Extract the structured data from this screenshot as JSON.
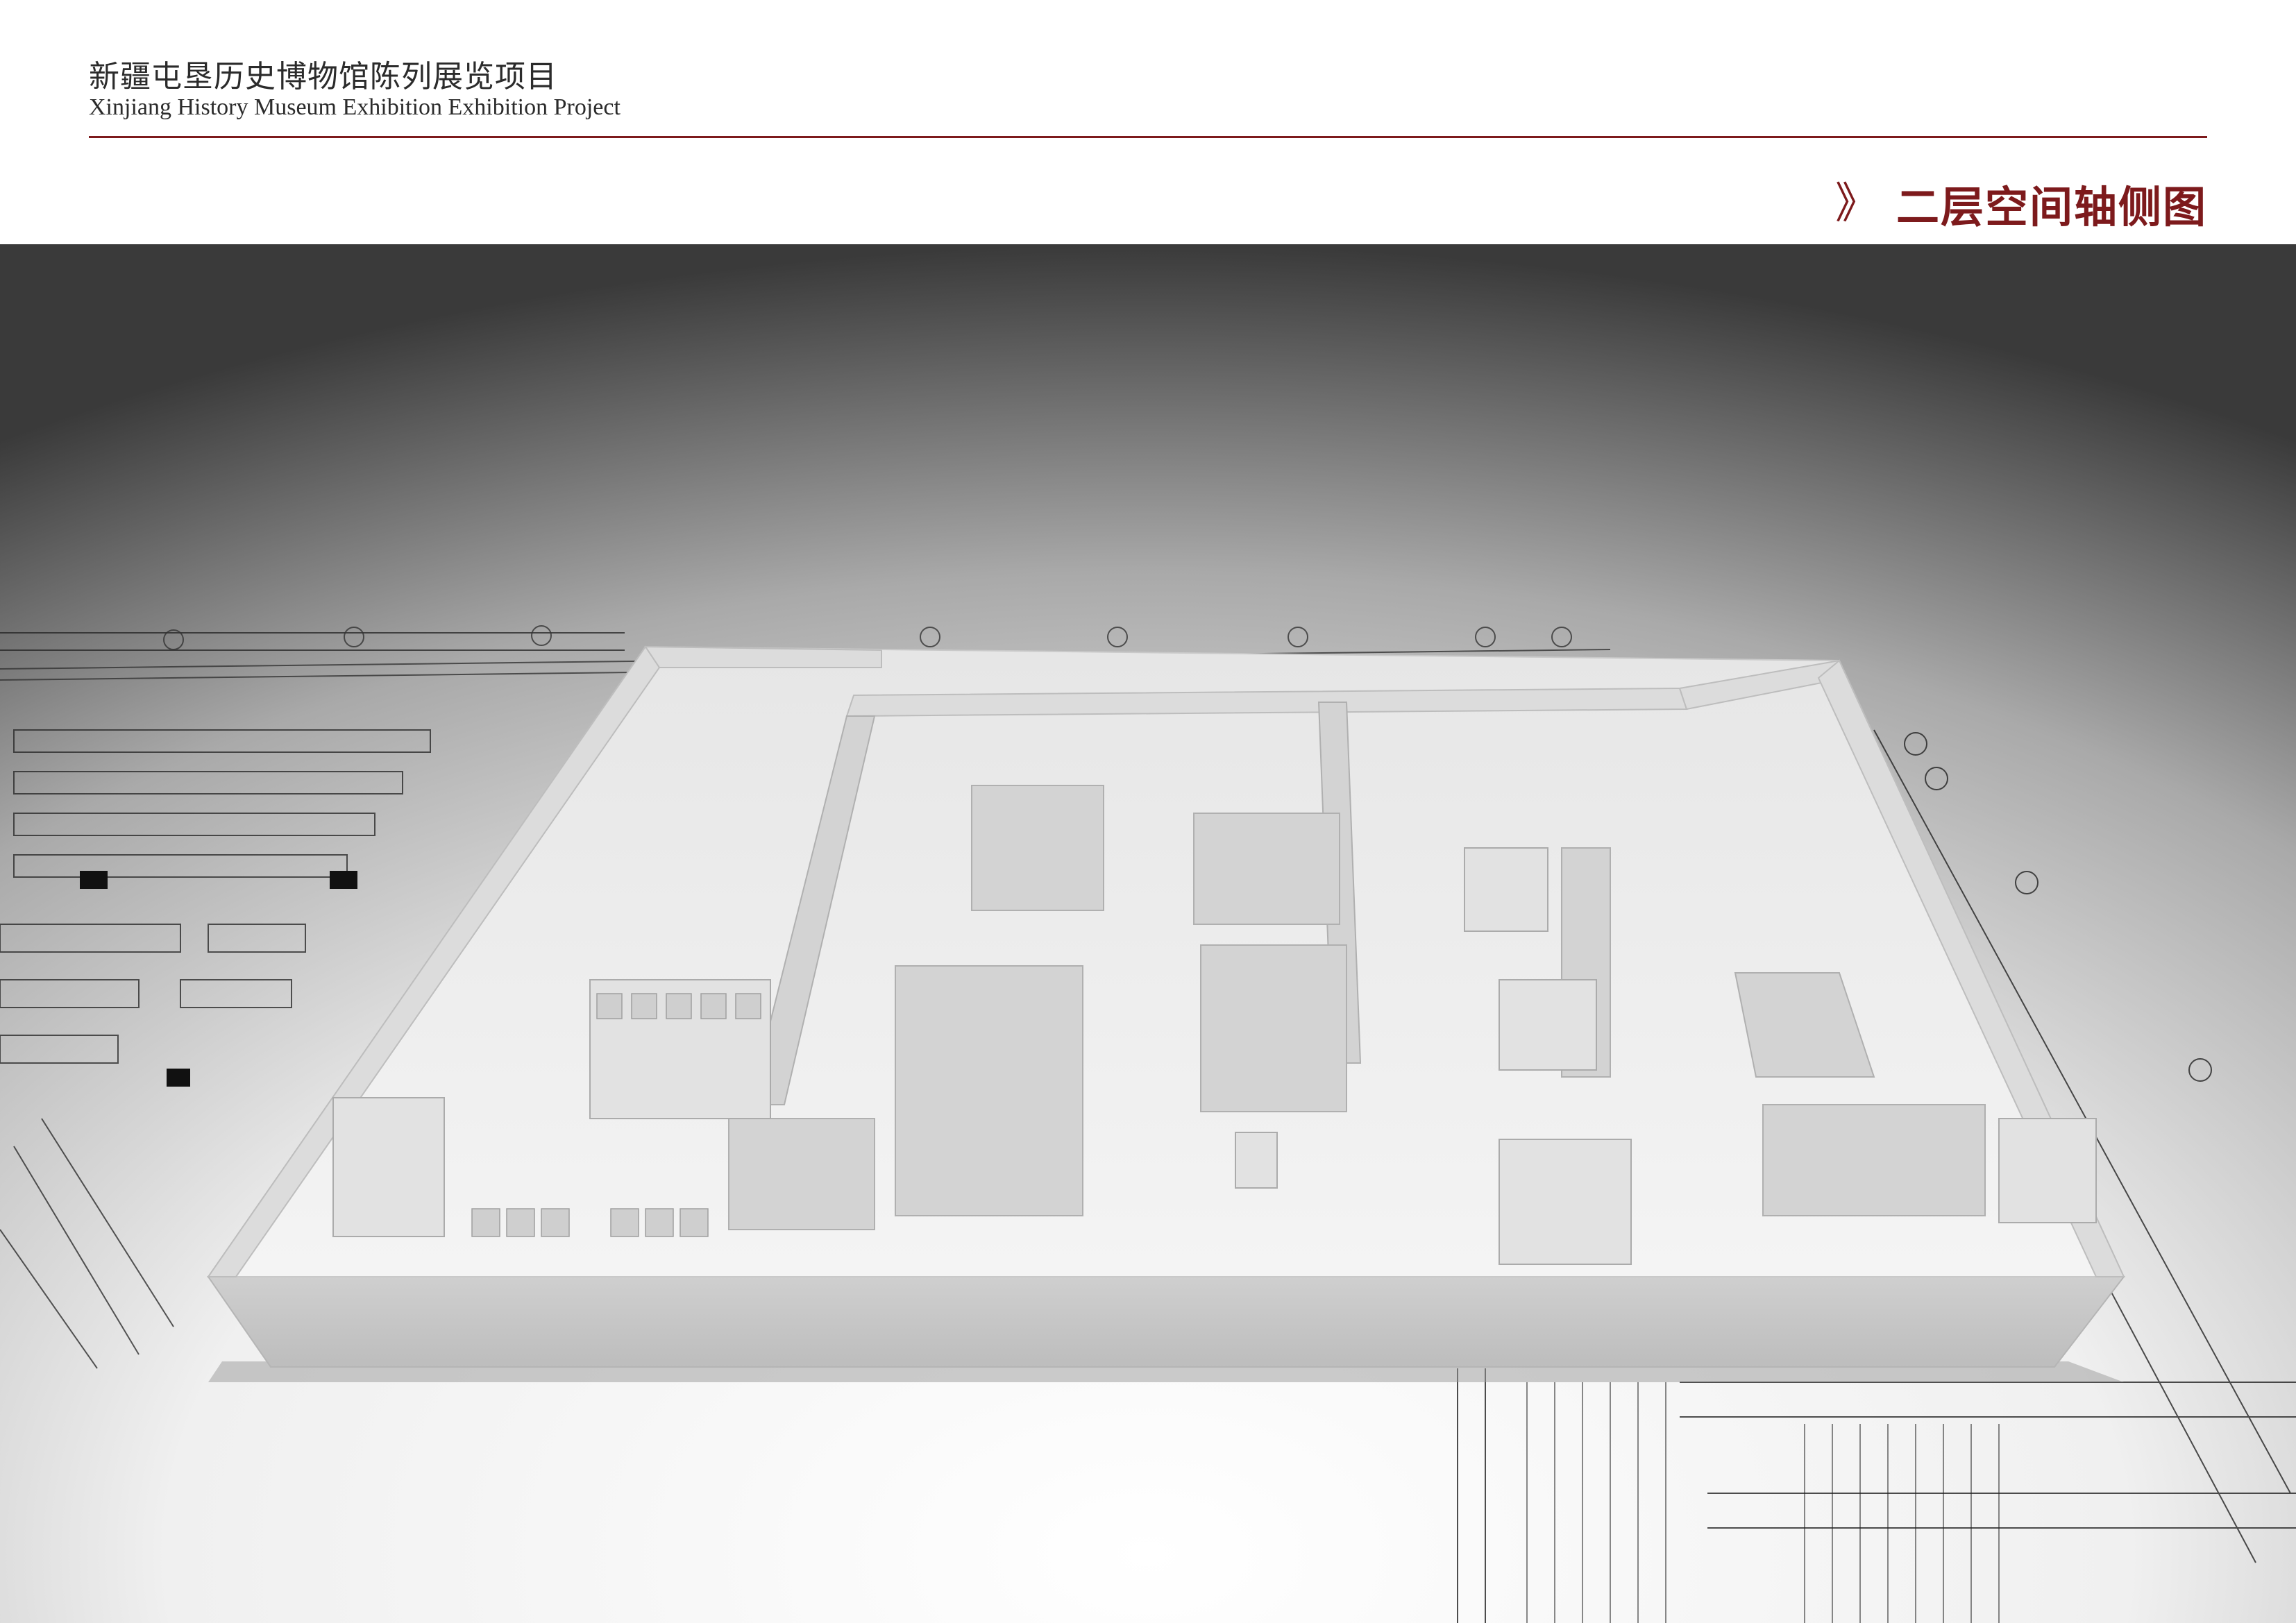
{
  "header": {
    "title_cn": "新疆屯垦历史博物馆陈列展览项目",
    "title_en": "Xinjiang History Museum Exhibition  Exhibition Project"
  },
  "section": {
    "icon": "double-chevron-right-icon",
    "title": "二层空间轴侧图"
  },
  "colors": {
    "accent": "#7d1a1c",
    "background_dark": "#3a3a3a",
    "model": "#d6d6d6"
  }
}
